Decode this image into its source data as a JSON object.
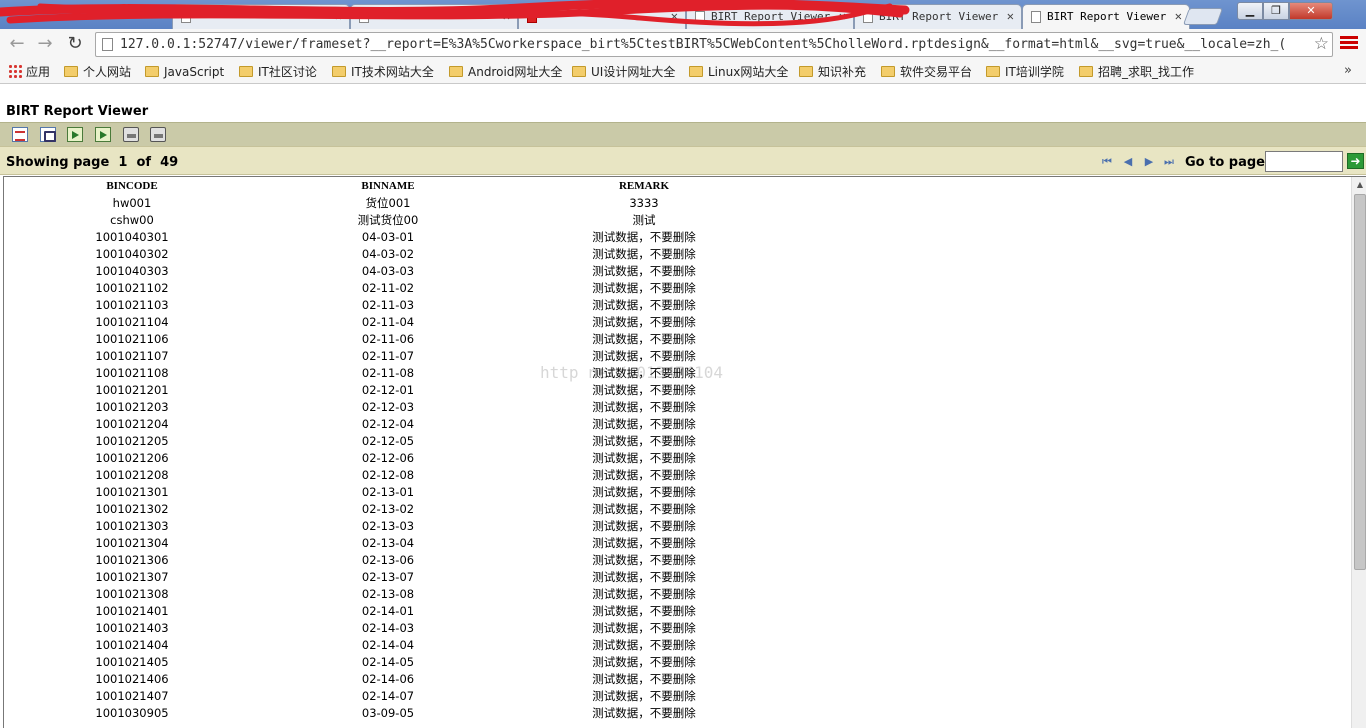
{
  "browser": {
    "tabs": [
      {
        "title": "",
        "icon": "doc-icon"
      },
      {
        "title": "",
        "icon": "csdn-icon"
      },
      {
        "title": "BIRT Report Viewer",
        "icon": "doc-icon"
      },
      {
        "title": "BIRT Report Viewer",
        "icon": "doc-icon"
      },
      {
        "title": "BIRT Report Viewer",
        "icon": "doc-icon",
        "active": true
      }
    ],
    "url": "127.0.0.1:52747/viewer/frameset?__report=E%3A%5Cworkerspace_birt%5CtestBIRT%5CWebContent%5CholleWord.rptdesign&__format=html&__svg=true&__locale=zh_(",
    "bookmarks": [
      {
        "label": "应用",
        "icon": "apps-icon"
      },
      {
        "label": "个人网站",
        "icon": "folder-icon"
      },
      {
        "label": "JavaScript",
        "icon": "folder-icon"
      },
      {
        "label": "IT社区讨论",
        "icon": "folder-icon"
      },
      {
        "label": "IT技术网站大全",
        "icon": "folder-icon"
      },
      {
        "label": "Android网址大全",
        "icon": "folder-icon"
      },
      {
        "label": "UI设计网址大全",
        "icon": "folder-icon"
      },
      {
        "label": "Linux网站大全",
        "icon": "folder-icon"
      },
      {
        "label": "知识补充",
        "icon": "folder-icon"
      },
      {
        "label": "软件交易平台",
        "icon": "folder-icon"
      },
      {
        "label": "IT培训学院",
        "icon": "folder-icon"
      },
      {
        "label": "招聘_求职_找工作",
        "icon": "folder-icon"
      }
    ],
    "more_label": "»"
  },
  "viewer": {
    "title": "BIRT Report Viewer",
    "toolbar": [
      "toc-icon",
      "parameter-icon",
      "export-data-icon",
      "export-report-icon",
      "print-icon",
      "print-server-icon"
    ],
    "nav": {
      "showing_prefix": "Showing page",
      "current_page": "1",
      "of_label": "of",
      "total_pages": "49",
      "goto_label": "Go to page:",
      "goto_value": ""
    }
  },
  "report": {
    "columns": [
      "BINCODE",
      "BINNAME",
      "REMARK"
    ],
    "watermark": "http                     net/u013474104",
    "rows": [
      [
        "hw001",
        "货位001",
        "3333"
      ],
      [
        "cshw00",
        "测试货位00",
        "测试"
      ],
      [
        "1001040301",
        "04-03-01",
        "测试数据，不要删除"
      ],
      [
        "1001040302",
        "04-03-02",
        "测试数据，不要删除"
      ],
      [
        "1001040303",
        "04-03-03",
        "测试数据，不要删除"
      ],
      [
        "1001021102",
        "02-11-02",
        "测试数据，不要删除"
      ],
      [
        "1001021103",
        "02-11-03",
        "测试数据，不要删除"
      ],
      [
        "1001021104",
        "02-11-04",
        "测试数据，不要删除"
      ],
      [
        "1001021106",
        "02-11-06",
        "测试数据，不要删除"
      ],
      [
        "1001021107",
        "02-11-07",
        "测试数据，不要删除"
      ],
      [
        "1001021108",
        "02-11-08",
        "测试数据，不要删除"
      ],
      [
        "1001021201",
        "02-12-01",
        "测试数据，不要删除"
      ],
      [
        "1001021203",
        "02-12-03",
        "测试数据，不要删除"
      ],
      [
        "1001021204",
        "02-12-04",
        "测试数据，不要删除"
      ],
      [
        "1001021205",
        "02-12-05",
        "测试数据，不要删除"
      ],
      [
        "1001021206",
        "02-12-06",
        "测试数据，不要删除"
      ],
      [
        "1001021208",
        "02-12-08",
        "测试数据，不要删除"
      ],
      [
        "1001021301",
        "02-13-01",
        "测试数据，不要删除"
      ],
      [
        "1001021302",
        "02-13-02",
        "测试数据，不要删除"
      ],
      [
        "1001021303",
        "02-13-03",
        "测试数据，不要删除"
      ],
      [
        "1001021304",
        "02-13-04",
        "测试数据，不要删除"
      ],
      [
        "1001021306",
        "02-13-06",
        "测试数据，不要删除"
      ],
      [
        "1001021307",
        "02-13-07",
        "测试数据，不要删除"
      ],
      [
        "1001021308",
        "02-13-08",
        "测试数据，不要删除"
      ],
      [
        "1001021401",
        "02-14-01",
        "测试数据，不要删除"
      ],
      [
        "1001021403",
        "02-14-03",
        "测试数据，不要删除"
      ],
      [
        "1001021404",
        "02-14-04",
        "测试数据，不要删除"
      ],
      [
        "1001021405",
        "02-14-05",
        "测试数据，不要删除"
      ],
      [
        "1001021406",
        "02-14-06",
        "测试数据，不要删除"
      ],
      [
        "1001021407",
        "02-14-07",
        "测试数据，不要删除"
      ],
      [
        "1001030905",
        "03-09-05",
        "测试数据，不要删除"
      ]
    ]
  },
  "colors": {
    "toolbar_bg": "#cacaa8",
    "navbar_bg": "#e8e5c3",
    "goto_button": "#2c9a37",
    "scribble_red": "#e0202a"
  }
}
